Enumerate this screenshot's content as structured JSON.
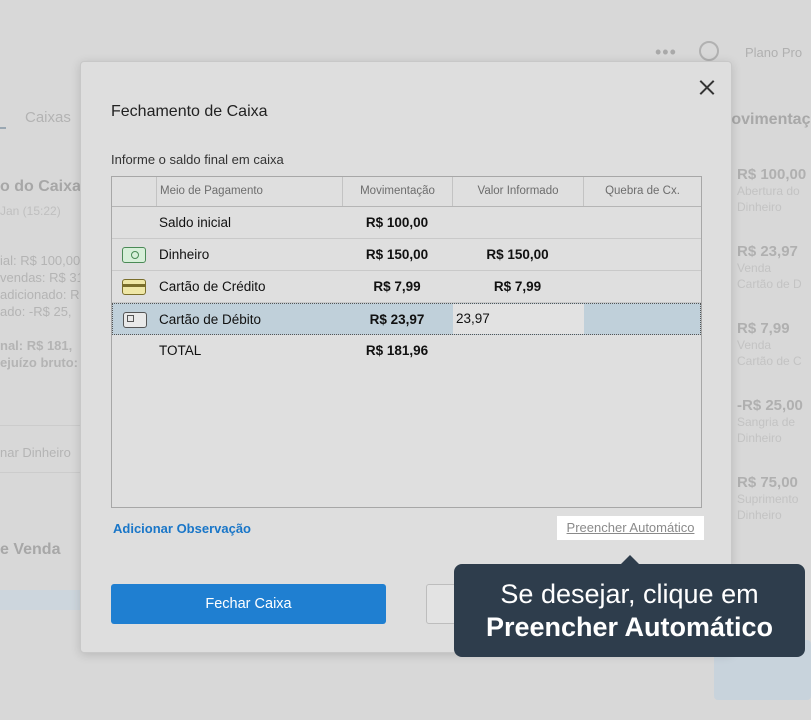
{
  "background": {
    "top_plan": "Plano Pro",
    "tab_caixas": "Caixas",
    "movements_title": "Movimentaç",
    "caixa_title": "o do Caixa",
    "caixa_date": "Jan (15:22)",
    "summary_lines": [
      "ial: R$ 100,00",
      "vendas: R$ 31",
      "adicionado: R",
      "ado: -R$ 25,",
      "",
      "nal: R$ 181,",
      "ejuízo bruto:"
    ],
    "add_cash": "nar Dinheiro",
    "sales_title": "e Venda",
    "movements": [
      {
        "amount": "R$ 100,00",
        "line1": "Abertura do",
        "line2": "Dinheiro"
      },
      {
        "amount": "R$ 23,97",
        "line1": "Venda",
        "line2": "Cartão de D"
      },
      {
        "amount": "R$ 7,99",
        "line1": "Venda",
        "line2": "Cartão de C"
      },
      {
        "amount": "-R$ 25,00",
        "line1": "Sangria de",
        "line2": "Dinheiro"
      },
      {
        "amount": "R$ 75,00",
        "line1": "Suprimento",
        "line2": "Dinheiro"
      }
    ]
  },
  "modal": {
    "title": "Fechamento de Caixa",
    "subtitle": "Informe o saldo final em caixa",
    "columns": [
      "Meio de Pagamento",
      "Movimentação",
      "Valor Informado",
      "Quebra de Cx."
    ],
    "rows": [
      {
        "label": "Saldo inicial",
        "movimentacao": "R$ 100,00",
        "informado": "",
        "quebra": "",
        "icon": ""
      },
      {
        "label": "Dinheiro",
        "movimentacao": "R$ 150,00",
        "informado": "R$ 150,00",
        "quebra": "",
        "icon": "cash-icon"
      },
      {
        "label": "Cartão de Crédito",
        "movimentacao": "R$ 7,99",
        "informado": "R$ 7,99",
        "quebra": "",
        "icon": "credit-card-icon"
      },
      {
        "label": "Cartão de Débito",
        "movimentacao": "R$ 23,97",
        "informado": "23,97",
        "quebra": "",
        "icon": "debit-card-icon"
      },
      {
        "label": "TOTAL",
        "movimentacao": "R$ 181,96",
        "informado": "",
        "quebra": "",
        "icon": ""
      }
    ],
    "add_note": "Adicionar Observação",
    "autofill": "Preencher Automático",
    "close_cash_button": "Fechar Caixa"
  },
  "tooltip": {
    "line1": "Se desejar, clique em",
    "line2": "Preencher Automático"
  },
  "colors": {
    "primary": "#1f7fd1",
    "link": "#1976c8",
    "tooltip_bg": "#2e3d4c",
    "selected_row": "#c0d0da"
  }
}
